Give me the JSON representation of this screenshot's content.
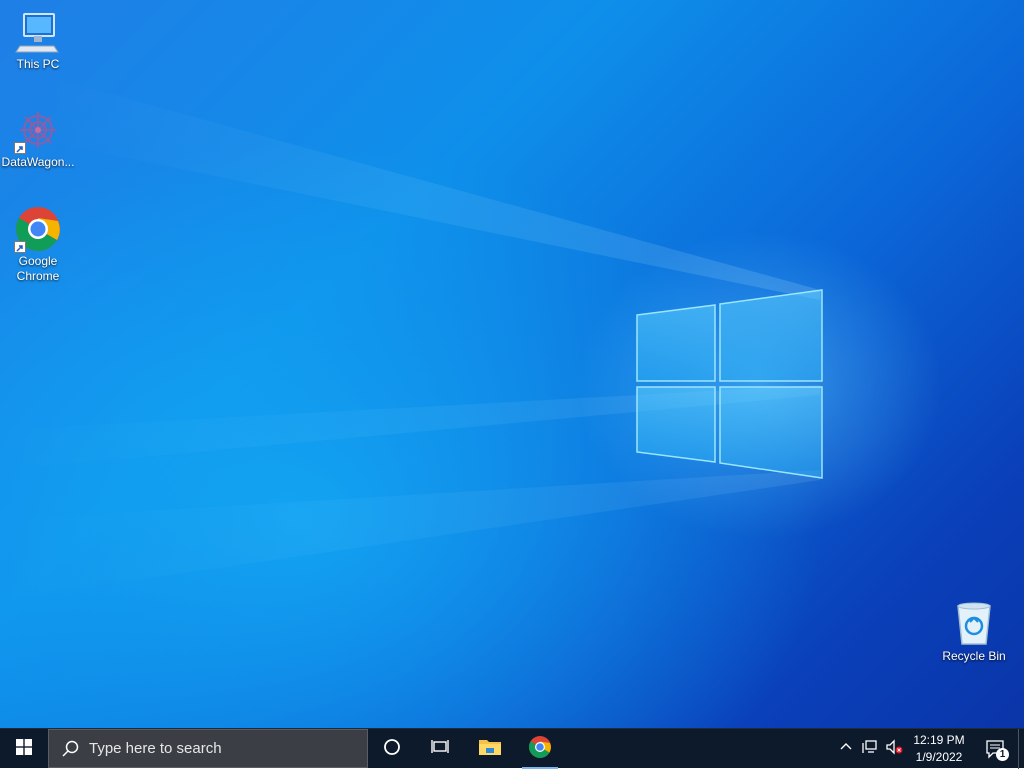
{
  "desktop": {
    "icons": [
      {
        "label": "This PC",
        "icon": "computer-icon"
      },
      {
        "label": "DataWagon...",
        "icon": "datawagon-app-icon"
      },
      {
        "label_line1": "Google",
        "label_line2": "Chrome",
        "icon": "chrome-icon"
      },
      {
        "label": "Recycle Bin",
        "icon": "recycle-bin-icon"
      }
    ]
  },
  "taskbar": {
    "start_icon": "windows-logo-icon",
    "search_placeholder": "Type here to search",
    "search_icon": "search-icon",
    "cortana_icon": "cortana-circle-icon",
    "task_view_icon": "task-view-icon",
    "pinned": [
      {
        "name": "File Explorer",
        "icon": "folder-icon"
      },
      {
        "name": "Google Chrome",
        "icon": "chrome-icon"
      }
    ],
    "tray": {
      "show_hidden_icon": "chevron-up-icon",
      "network_icon": "network-icon",
      "volume_icon": "volume-muted-icon",
      "time": "12:19 PM",
      "date": "1/9/2022",
      "notification_count": "1",
      "notification_icon": "action-center-icon"
    }
  },
  "colors": {
    "wallpaper_blue": "#0b68d8",
    "taskbar": "#0d1a2b",
    "search_box": "#3b3f45"
  }
}
